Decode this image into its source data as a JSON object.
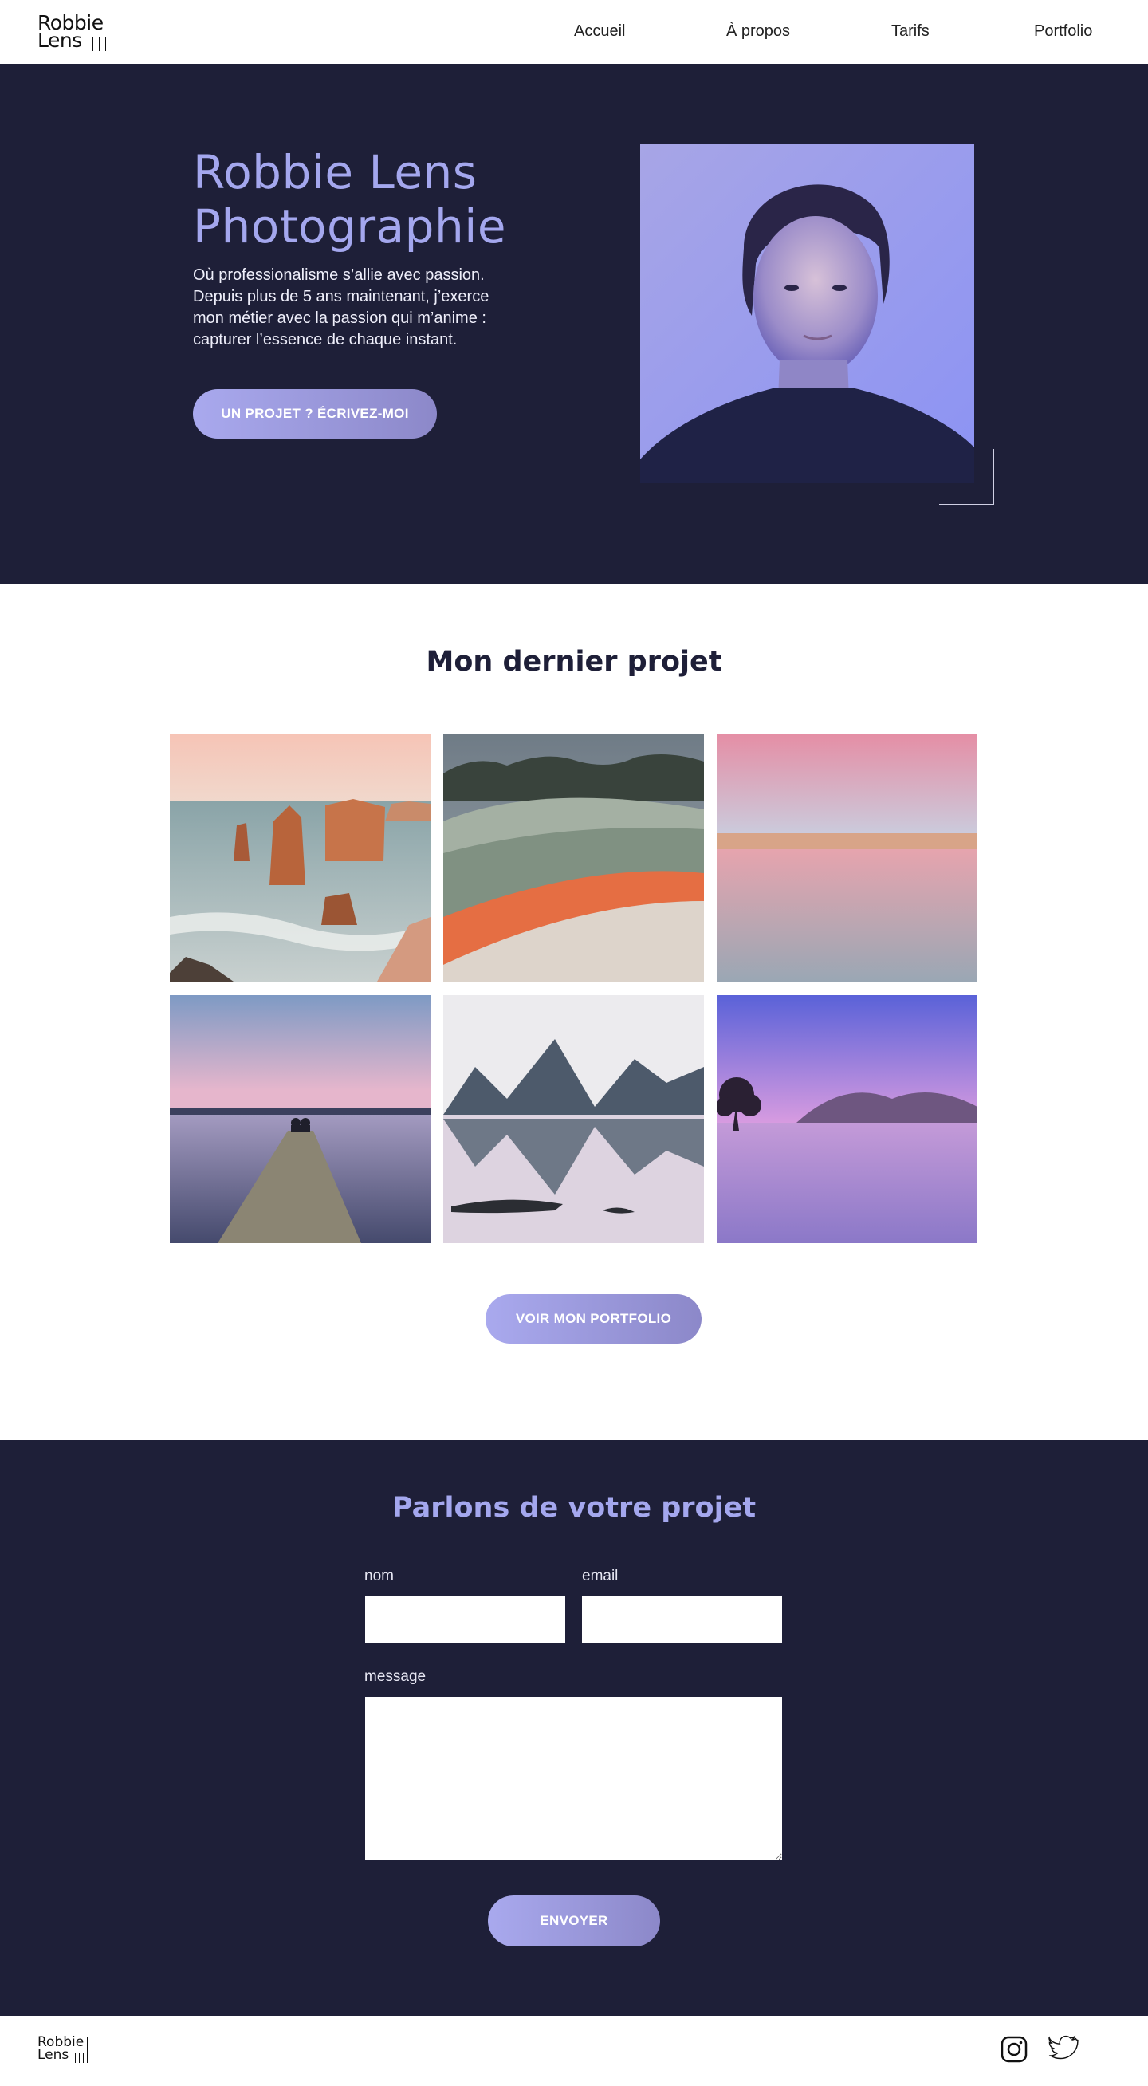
{
  "logo": {
    "line1": "Robbie",
    "line2": "Lens"
  },
  "nav": {
    "items": [
      "Accueil",
      "À propos",
      "Tarifs",
      "Portfolio"
    ]
  },
  "hero": {
    "title_line1": "Robbie Lens",
    "title_line2": "Photographie",
    "text": "Où professionalisme s’allie avec passion. Depuis plus de 5 ans maintenant, j’exerce mon métier avec la passion qui m’anime : capturer l’essence de chaque instant.",
    "cta": "UN PROJET ? ÉCRIVEZ-MOI"
  },
  "project": {
    "title": "Mon dernier projet",
    "gallery": [
      "coastal-rock-stacks",
      "geothermal-pool",
      "pink-sky-lake",
      "wooden-pier-dusk",
      "mountain-reflection",
      "lone-tree-lake"
    ],
    "cta": "VOIR MON PORTFOLIO"
  },
  "contact": {
    "title": "Parlons de votre projet",
    "name_label": "nom",
    "email_label": "email",
    "message_label": "message",
    "submit": "ENVOYER"
  },
  "footer": {
    "social": [
      "instagram-icon",
      "twitter-icon"
    ]
  },
  "colors": {
    "navy": "#1e1f38",
    "lavender": "#a4a7ee",
    "button_gradient_start": "#a9a9ee",
    "button_gradient_end": "#8c88c9"
  }
}
